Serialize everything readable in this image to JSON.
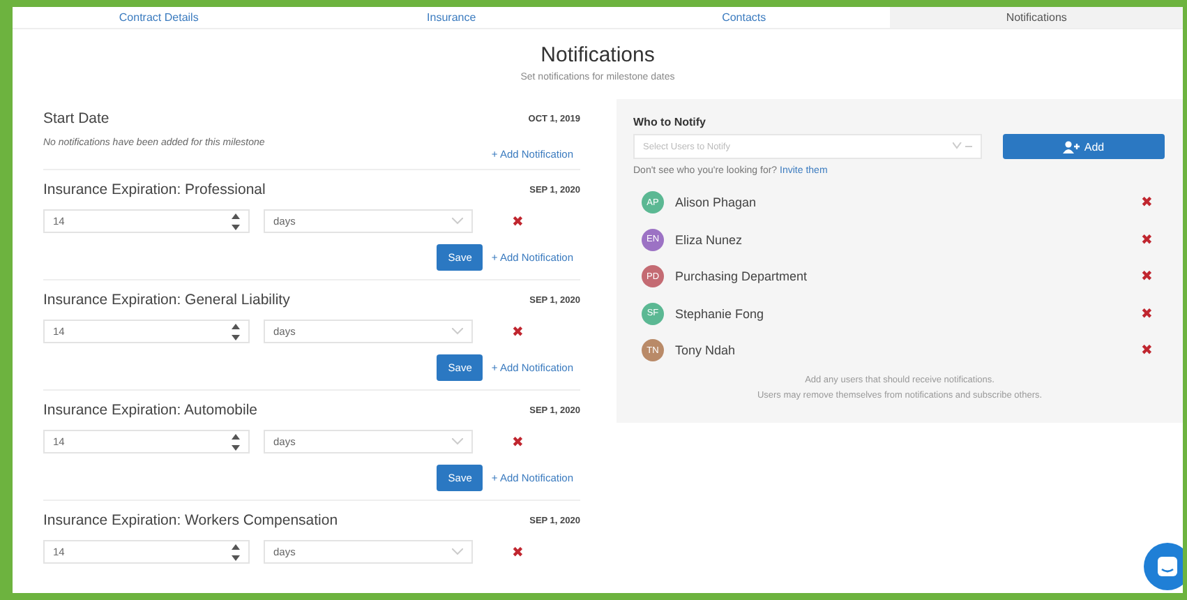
{
  "tabs": [
    {
      "label": "Contract Details",
      "selected": false
    },
    {
      "label": "Insurance",
      "selected": false
    },
    {
      "label": "Contacts",
      "selected": false
    },
    {
      "label": "Notifications",
      "selected": true
    }
  ],
  "title": "Notifications",
  "subtitle": "Set notifications for milestone dates",
  "milestones": [
    {
      "name": "Start Date",
      "date": "OCT 1, 2019",
      "empty_text": "No notifications have been added for this milestone",
      "add_label": "+ Add Notification"
    },
    {
      "name": "Insurance Expiration: Professional",
      "date": "SEP 1, 2020",
      "notifications": [
        {
          "value": "14",
          "unit": "days",
          "remove": "✖"
        }
      ],
      "save_label": "Save",
      "add_label": "+ Add Notification"
    },
    {
      "name": "Insurance Expiration: General Liability",
      "date": "SEP 1, 2020",
      "notifications": [
        {
          "value": "14",
          "unit": "days",
          "remove": "✖"
        }
      ],
      "save_label": "Save",
      "add_label": "+ Add Notification"
    },
    {
      "name": "Insurance Expiration: Automobile",
      "date": "SEP 1, 2020",
      "notifications": [
        {
          "value": "14",
          "unit": "days",
          "remove": "✖"
        }
      ],
      "save_label": "Save",
      "add_label": "+ Add Notification"
    },
    {
      "name": "Insurance Expiration: Workers Compensation",
      "date": "SEP 1, 2020",
      "notifications": [
        {
          "value": "14",
          "unit": "days",
          "remove": "✖"
        }
      ]
    }
  ],
  "notify": {
    "label": "Who to Notify",
    "placeholder": "Select Users to Notify",
    "add_button": "Add",
    "hint": "Don't see who you're looking for?",
    "invite_link": "Invite them",
    "users": [
      {
        "initials": "AP",
        "name": "Alison Phagan",
        "color": "#5bb893",
        "remove": "✖"
      },
      {
        "initials": "EN",
        "name": "Eliza Nunez",
        "color": "#9c72c4",
        "remove": "✖"
      },
      {
        "initials": "PD",
        "name": "Purchasing Department",
        "color": "#c46b73",
        "remove": "✖"
      },
      {
        "initials": "SF",
        "name": "Stephanie Fong",
        "color": "#5bb893",
        "remove": "✖"
      },
      {
        "initials": "TN",
        "name": "Tony Ndah",
        "color": "#b98a68",
        "remove": "✖"
      }
    ],
    "footer_lines": [
      "Add any users that should receive notifications.",
      "Users may remove themselves from notifications and subscribe others."
    ]
  }
}
